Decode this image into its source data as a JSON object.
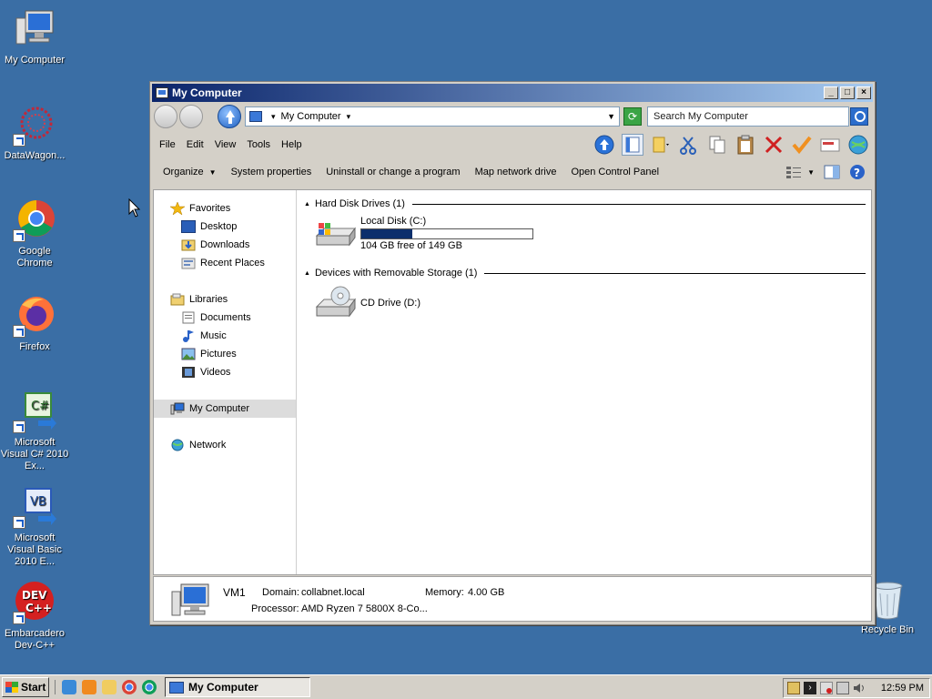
{
  "desktop": {
    "icons": [
      {
        "label": "My Computer"
      },
      {
        "label": "DataWagon..."
      },
      {
        "label": "Google Chrome"
      },
      {
        "label": "Firefox"
      },
      {
        "label": "Microsoft Visual C# 2010 Ex..."
      },
      {
        "label": "Microsoft Visual Basic 2010 E..."
      },
      {
        "label": "Embarcadero Dev-C++"
      }
    ],
    "recycle_bin": "Recycle Bin"
  },
  "window": {
    "title": "My Computer",
    "address": {
      "location": "My Computer"
    },
    "search": {
      "placeholder": "Search My Computer"
    },
    "menu": [
      "File",
      "Edit",
      "View",
      "Tools",
      "Help"
    ],
    "commands": {
      "organize": "Organize",
      "system_properties": "System properties",
      "uninstall": "Uninstall or change a program",
      "map_drive": "Map network drive",
      "control_panel": "Open Control Panel"
    },
    "nav": {
      "favorites": "Favorites",
      "desktop": "Desktop",
      "downloads": "Downloads",
      "recent": "Recent Places",
      "libraries": "Libraries",
      "documents": "Documents",
      "music": "Music",
      "pictures": "Pictures",
      "videos": "Videos",
      "my_computer": "My Computer",
      "network": "Network"
    },
    "groups": {
      "hard_disks": "Hard Disk Drives (1)",
      "removable": "Devices with Removable Storage (1)"
    },
    "drives": {
      "c": {
        "name": "Local Disk (C:)",
        "free_text": "104 GB free of 149 GB",
        "used_fraction": 0.3
      },
      "d": {
        "name": "CD Drive (D:)"
      }
    },
    "details": {
      "name": "VM1",
      "domain_label": "Domain:",
      "domain_value": "collabnet.local",
      "memory_label": "Memory:",
      "memory_value": "4.00 GB",
      "processor_label": "Processor:",
      "processor_value": "AMD Ryzen 7 5800X 8-Co..."
    }
  },
  "taskbar": {
    "start": "Start",
    "task": "My Computer",
    "clock": "12:59 PM"
  },
  "colors": {
    "desktop": "#3a6ea5",
    "title_start": "#0a246a",
    "title_end": "#a6caf0",
    "disk_fill": "#0c2f6c"
  }
}
